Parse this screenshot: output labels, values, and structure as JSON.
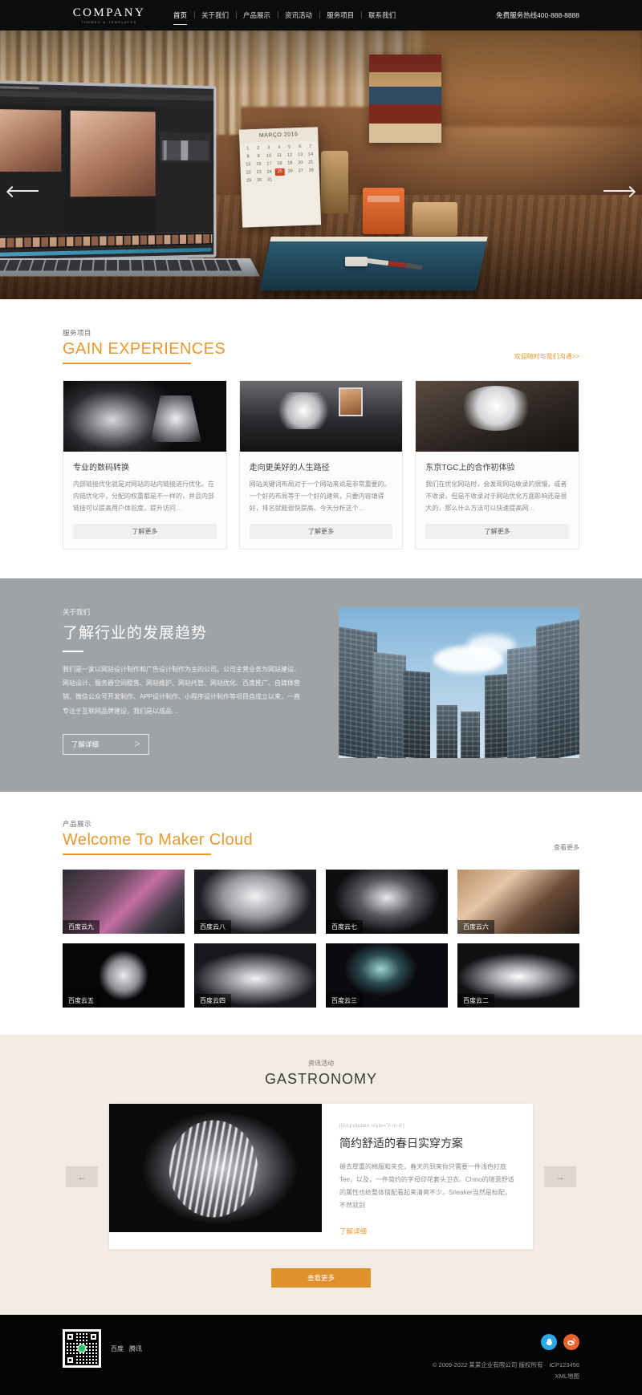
{
  "header": {
    "logo": {
      "main": "COMPANY",
      "sub": "THEMES & TEMPLATES"
    },
    "nav": [
      {
        "label": "首页",
        "active": true
      },
      {
        "label": "关于我们",
        "active": false
      },
      {
        "label": "产品展示",
        "active": false
      },
      {
        "label": "资讯活动",
        "active": false
      },
      {
        "label": "服务项目",
        "active": false
      },
      {
        "label": "联系我们",
        "active": false
      }
    ],
    "hotline": "免费服务热线400-888-8888"
  },
  "hero": {
    "prev_label": "上一张",
    "next_label": "下一张",
    "calendar_month": "MARÇO 2016",
    "calendar_days": [
      "1",
      "2",
      "3",
      "4",
      "5",
      "6",
      "7",
      "8",
      "9",
      "10",
      "11",
      "12",
      "13",
      "14",
      "15",
      "16",
      "17",
      "18",
      "19",
      "20",
      "21",
      "22",
      "23",
      "24",
      "25",
      "26",
      "27",
      "28",
      "29",
      "30",
      "31"
    ],
    "calendar_highlight": "25"
  },
  "services": {
    "kicker": "服务项目",
    "title": "GAIN EXPERIENCES",
    "more": "欢迎随时与我们沟通>>",
    "cards": [
      {
        "title": "专业的数码转换",
        "desc": "内部链接优化就是对网站的站内链接进行优化。在内链优化中，分配的权重都是不一样的，并且内部链接可以提高用户体验度，提升访问…",
        "button": "了解更多"
      },
      {
        "title": "走向更美好的人生路径",
        "desc": "网站关键词布局对于一个网站来说是非常重要的。一个好的布局等于一个好的建筑，只要内容填得好，排名就能很快提高。今天分析这个…",
        "button": "了解更多"
      },
      {
        "title": "东京TGC上的合作初体验",
        "desc": "我们在优化网站时，会发现网站收录的很慢，或者不收录，但是不收录对于网站优化方面影响还是很大的，那么什么方法可以快速提高网…",
        "button": "了解更多"
      }
    ]
  },
  "about": {
    "kicker": "关于我们",
    "title": "了解行业的发展趋势",
    "text": "我们是一家以网站设计制作和广告设计制作为主的公司。公司主营业务为网站建设、网站设计、服务器空间租售、网站维护、网站托管、网站优化、百度推广、自媒体营销、微信公众号开发制作、APP设计制作、小程序设计制作等项目自成立以来，一直专注于互联网品牌建设，我们是以成品…",
    "button": "了解详细",
    "button_arrow": "＞"
  },
  "products": {
    "kicker": "产品展示",
    "title": "Welcome To Maker Cloud",
    "more": "查看更多",
    "items": [
      {
        "label": "百度云九"
      },
      {
        "label": "百度云八"
      },
      {
        "label": "百度云七"
      },
      {
        "label": "百度云六"
      },
      {
        "label": "百度云五"
      },
      {
        "label": "百度云四"
      },
      {
        "label": "百度云三"
      },
      {
        "label": "百度云二"
      }
    ]
  },
  "news": {
    "kicker": "资讯活动",
    "title": "GASTRONOMY",
    "prev_label": "←",
    "next_label": "→",
    "article": {
      "date": "[list:pubdate style='Y-m-d']",
      "title": "简约舒适的春日实穿方案",
      "excerpt": "褪去厚重的棉服和夹克，春天的到来你只需要一件浅色打底Tee，以及，一件简约的字母印花套头卫衣。Chino的随意舒适的属性也给整体搭配看起来清爽不少。Sneaker当然是标配，不然就别",
      "link": "了解详细"
    },
    "more_button": "查看更多"
  },
  "footer": {
    "qr_alt": "二维码",
    "links": [
      "百度",
      "腾讯"
    ],
    "social": [
      {
        "name": "qq",
        "glyph": "🐧"
      },
      {
        "name": "weibo",
        "glyph": "◉"
      }
    ],
    "copyright": "© 2009-2022 某某企业有限公司 版权所有",
    "icp": "ICP123456",
    "xml": "XML地图"
  },
  "colors": {
    "accent": "#e8992c",
    "accent_button": "#e0912c",
    "header_bg": "#0d0c0c",
    "about_bg": "#a0a3a6",
    "news_bg": "#f3ece3",
    "footer_bg": "#050505"
  }
}
